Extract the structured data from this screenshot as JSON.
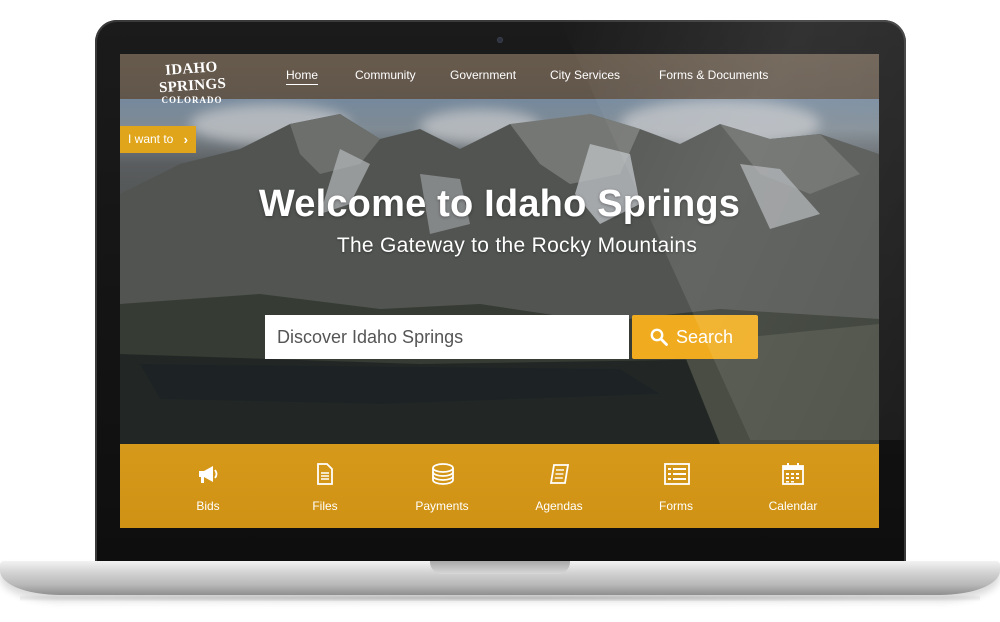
{
  "site": {
    "logo": {
      "main": "IDAHO SPRINGS",
      "sub": "COLORADO"
    }
  },
  "nav": {
    "items": [
      {
        "label": "Home",
        "active": true
      },
      {
        "label": "Community"
      },
      {
        "label": "Government"
      },
      {
        "label": "City Services"
      },
      {
        "label": "Forms & Documents"
      }
    ]
  },
  "i_want_to": {
    "label": "I want to",
    "icon": "chevron-right-icon"
  },
  "hero": {
    "title": "Welcome to Idaho Springs",
    "subtitle": "The Gateway to the Rocky Mountains"
  },
  "search": {
    "placeholder": "Discover Idaho Springs",
    "button_label": "Search",
    "icon": "search-icon"
  },
  "quick_links": [
    {
      "label": "Bids",
      "icon": "megaphone-icon"
    },
    {
      "label": "Files",
      "icon": "file-icon"
    },
    {
      "label": "Payments",
      "icon": "coins-icon"
    },
    {
      "label": "Agendas",
      "icon": "notebook-icon"
    },
    {
      "label": "Forms",
      "icon": "form-icon"
    },
    {
      "label": "Calendar",
      "icon": "calendar-icon"
    }
  ],
  "colors": {
    "accent": "#f0ac1e",
    "quickbar": "#d7991a",
    "topbar": "#695a4a"
  }
}
